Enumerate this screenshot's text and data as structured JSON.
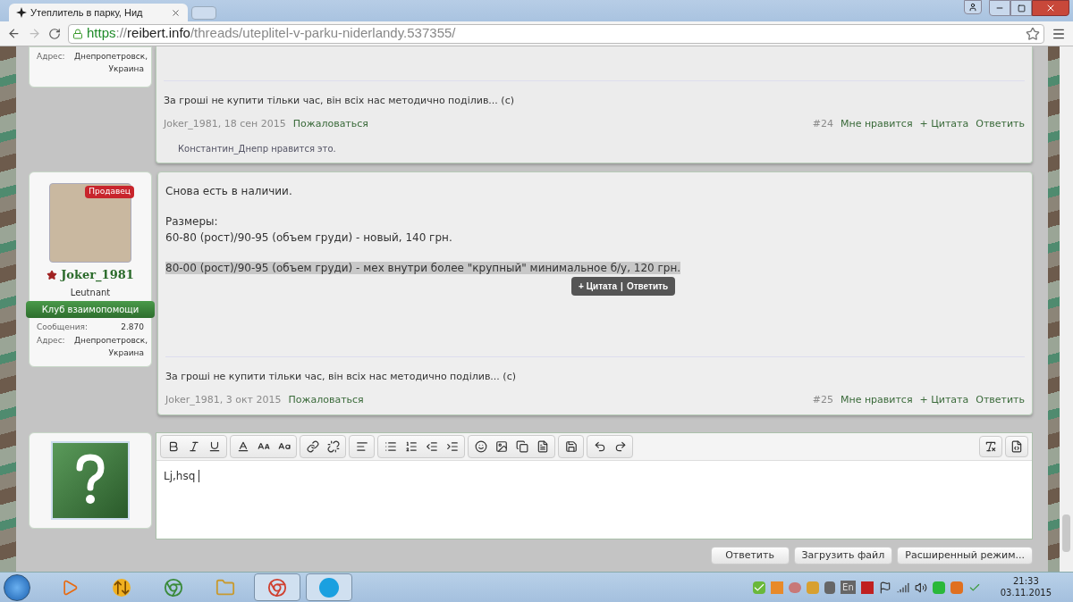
{
  "browser": {
    "tab_title": "Утеплитель в парку, Нид",
    "url_parts": [
      {
        "kind": "scheme",
        "text": "https"
      },
      {
        "kind": "sep",
        "text": "://"
      },
      {
        "kind": "host",
        "text": "reibert.info"
      },
      {
        "kind": "path",
        "text": "/threads/uteplitel-v-parku-niderlandy.537355/"
      }
    ]
  },
  "posts": [
    {
      "user": {
        "stats": [
          {
            "label": "Адрес:",
            "value": "Днепропетровск, Украина"
          }
        ]
      },
      "signature": "За гроші не купити тільки час, він всіх нас методично поділив... (с)",
      "meta": "Joker_1981, 18 сен 2015",
      "report": "Пожаловаться",
      "number": "#24",
      "actions": [
        "Мне нравится",
        "+ Цитата",
        "Ответить"
      ],
      "likes": "Константин_Днепр нравится это."
    },
    {
      "user": {
        "badge": "Продавец",
        "name": "Joker_1981",
        "rank": "Leutnant",
        "banner": "Клуб взаимопомощи",
        "stats": [
          {
            "label": "Сообщения:",
            "value": "2.870"
          },
          {
            "label": "Адрес:",
            "value": "Днепропетровск, Украина"
          }
        ]
      },
      "body": [
        {
          "lines": [
            "Снова есть в наличии."
          ],
          "selected": false
        },
        {
          "lines": [
            "Размеры:",
            "60-80 (рост)/90-95 (объем груди) - новый, 140 грн."
          ],
          "selected": false
        },
        {
          "lines": [
            "80-00 (рост)/90-95 (объем груди) - мех внутри более \"крупный\" минимальное б/у, 120 грн."
          ],
          "selected": true
        }
      ],
      "tooltip": {
        "items": [
          "+ Цитата",
          "Ответить"
        ],
        "separator": "|"
      },
      "signature": "За гроші не купити тільки час, він всіх нас методично поділив... (с)",
      "meta": "Joker_1981, 3 окт 2015",
      "report": "Пожаловаться",
      "number": "#25",
      "actions": [
        "Мне нравится",
        "+ Цитата",
        "Ответить"
      ]
    }
  ],
  "editor": {
    "toolbar": [
      [
        {
          "kind": "bold"
        },
        {
          "kind": "italic"
        },
        {
          "kind": "underline"
        }
      ],
      [
        {
          "kind": "color"
        },
        {
          "kind": "size"
        },
        {
          "kind": "font"
        }
      ],
      [
        {
          "kind": "link"
        },
        {
          "kind": "unlink"
        }
      ],
      [
        {
          "kind": "align"
        }
      ],
      [
        {
          "kind": "bullets"
        },
        {
          "kind": "numbers"
        },
        {
          "kind": "outdent"
        },
        {
          "kind": "indent"
        }
      ],
      [
        {
          "kind": "smile"
        },
        {
          "kind": "image"
        },
        {
          "kind": "media"
        },
        {
          "kind": "code"
        }
      ],
      [
        {
          "kind": "save"
        }
      ],
      [
        {
          "kind": "undo"
        },
        {
          "kind": "redo"
        }
      ]
    ],
    "toolbar_right": [
      {
        "kind": "removeformat"
      },
      {
        "kind": "source"
      }
    ],
    "text": "Lj,hsq",
    "buttons": [
      "Ответить",
      "Загрузить файл",
      "Расширенный режим..."
    ]
  },
  "taskbar": {
    "apps": [
      {
        "kind": "media",
        "running": false
      },
      {
        "kind": "arrows",
        "running": false
      },
      {
        "kind": "chrome-old",
        "running": false
      },
      {
        "kind": "folder",
        "running": false
      },
      {
        "kind": "chrome",
        "running": true
      },
      {
        "kind": "skype",
        "running": true
      }
    ],
    "language": "En",
    "time": "21:33",
    "date": "03.11.2015"
  }
}
